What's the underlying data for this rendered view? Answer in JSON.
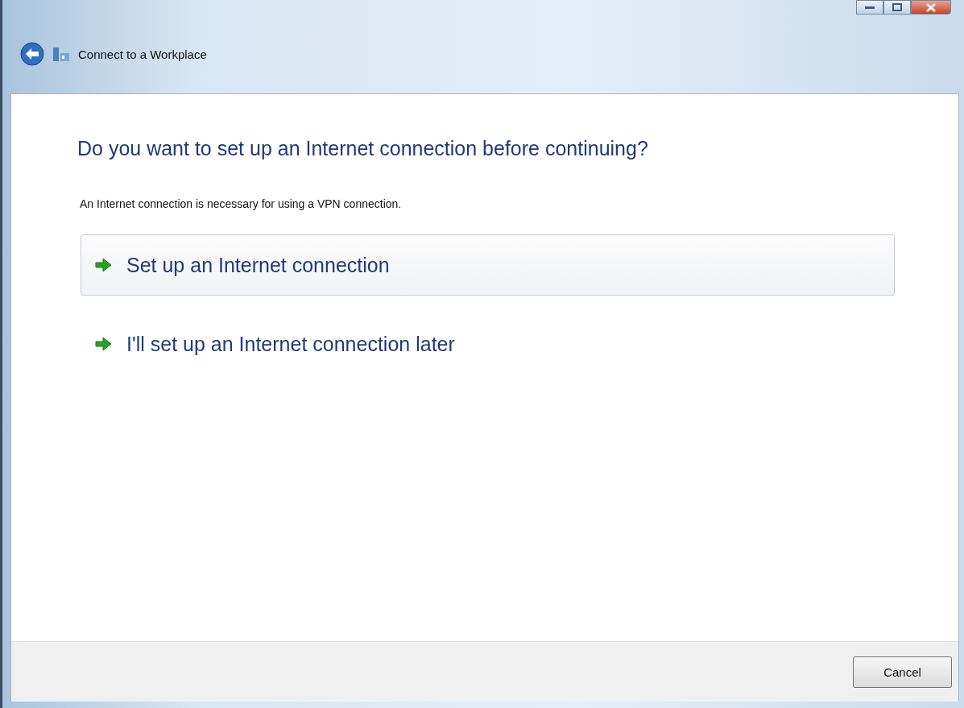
{
  "window": {
    "title": "Connect to a Workplace"
  },
  "heading": "Do you want to set up an Internet connection before continuing?",
  "description": "An Internet connection is necessary for using a VPN connection.",
  "options": [
    {
      "label": "Set up an Internet connection",
      "highlighted": true
    },
    {
      "label": "I'll set up an Internet connection later",
      "highlighted": false
    }
  ],
  "buttons": [
    "Cancel"
  ]
}
